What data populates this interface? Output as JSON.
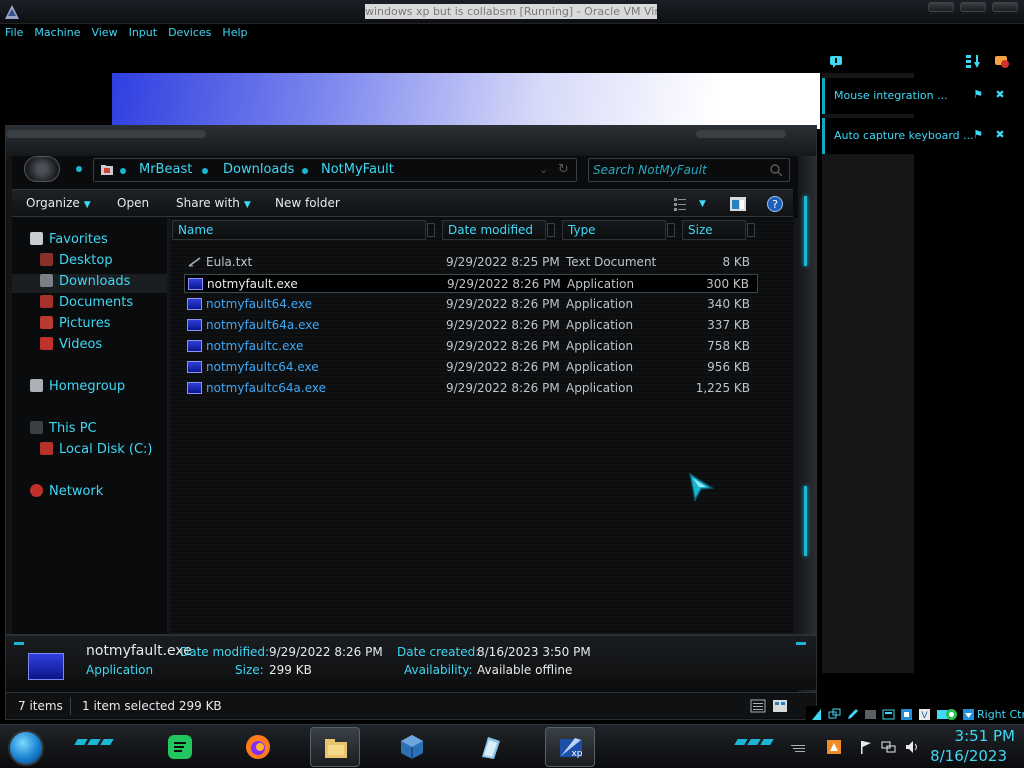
{
  "host": {
    "title": "windows xp but is collabsm [Running] - Oracle VM VirtualBox",
    "menu": [
      "File",
      "Machine",
      "View",
      "Input",
      "Devices",
      "Help"
    ],
    "right_ctrl_label": "Right Ctrl"
  },
  "notifications": [
    {
      "label": "Mouse integration ..."
    },
    {
      "label": "Auto capture keyboard ..."
    }
  ],
  "explorer": {
    "breadcrumb": [
      "MrBeast",
      "Downloads",
      "NotMyFault"
    ],
    "search_placeholder": "Search NotMyFault",
    "toolbar": {
      "organize": "Organize",
      "open": "Open",
      "share_with": "Share with",
      "new_folder": "New folder"
    },
    "nav": {
      "favorites": "Favorites",
      "desktop": "Desktop",
      "downloads": "Downloads",
      "documents": "Documents",
      "pictures": "Pictures",
      "videos": "Videos",
      "homegroup": "Homegroup",
      "this_pc": "This PC",
      "local_disk": "Local Disk (C:)",
      "network": "Network"
    },
    "columns": {
      "name": "Name",
      "date_modified": "Date modified",
      "type": "Type",
      "size": "Size"
    },
    "files": [
      {
        "name": "Eula.txt",
        "date": "9/29/2022 8:25 PM",
        "type": "Text Document",
        "size": "8 KB",
        "icon": "text-file-icon"
      },
      {
        "name": "notmyfault.exe",
        "date": "9/29/2022 8:26 PM",
        "type": "Application",
        "size": "300 KB",
        "icon": "application-icon",
        "selected": true
      },
      {
        "name": "notmyfault64.exe",
        "date": "9/29/2022 8:26 PM",
        "type": "Application",
        "size": "340 KB",
        "icon": "application-icon"
      },
      {
        "name": "notmyfault64a.exe",
        "date": "9/29/2022 8:26 PM",
        "type": "Application",
        "size": "337 KB",
        "icon": "application-icon"
      },
      {
        "name": "notmyfaultc.exe",
        "date": "9/29/2022 8:26 PM",
        "type": "Application",
        "size": "758 KB",
        "icon": "application-icon"
      },
      {
        "name": "notmyfaultc64.exe",
        "date": "9/29/2022 8:26 PM",
        "type": "Application",
        "size": "956 KB",
        "icon": "application-icon"
      },
      {
        "name": "notmyfaultc64a.exe",
        "date": "9/29/2022 8:26 PM",
        "type": "Application",
        "size": "1,225 KB",
        "icon": "application-icon"
      }
    ],
    "details": {
      "name": "notmyfault.exe",
      "type": "Application",
      "date_modified_label": "Date modified:",
      "date_modified": "9/29/2022 8:26 PM",
      "size_label": "Size:",
      "size": "299 KB",
      "date_created_label": "Date created:",
      "date_created": "8/16/2023 3:50 PM",
      "availability_label": "Availability:",
      "availability": "Available offline"
    },
    "status": {
      "items_count": "7 items",
      "selection": "1 item selected  299 KB"
    }
  },
  "taskbar": {
    "clock_time": "3:51 PM",
    "clock_date": "8/16/2023",
    "accent_color": "#3fd8f5"
  }
}
